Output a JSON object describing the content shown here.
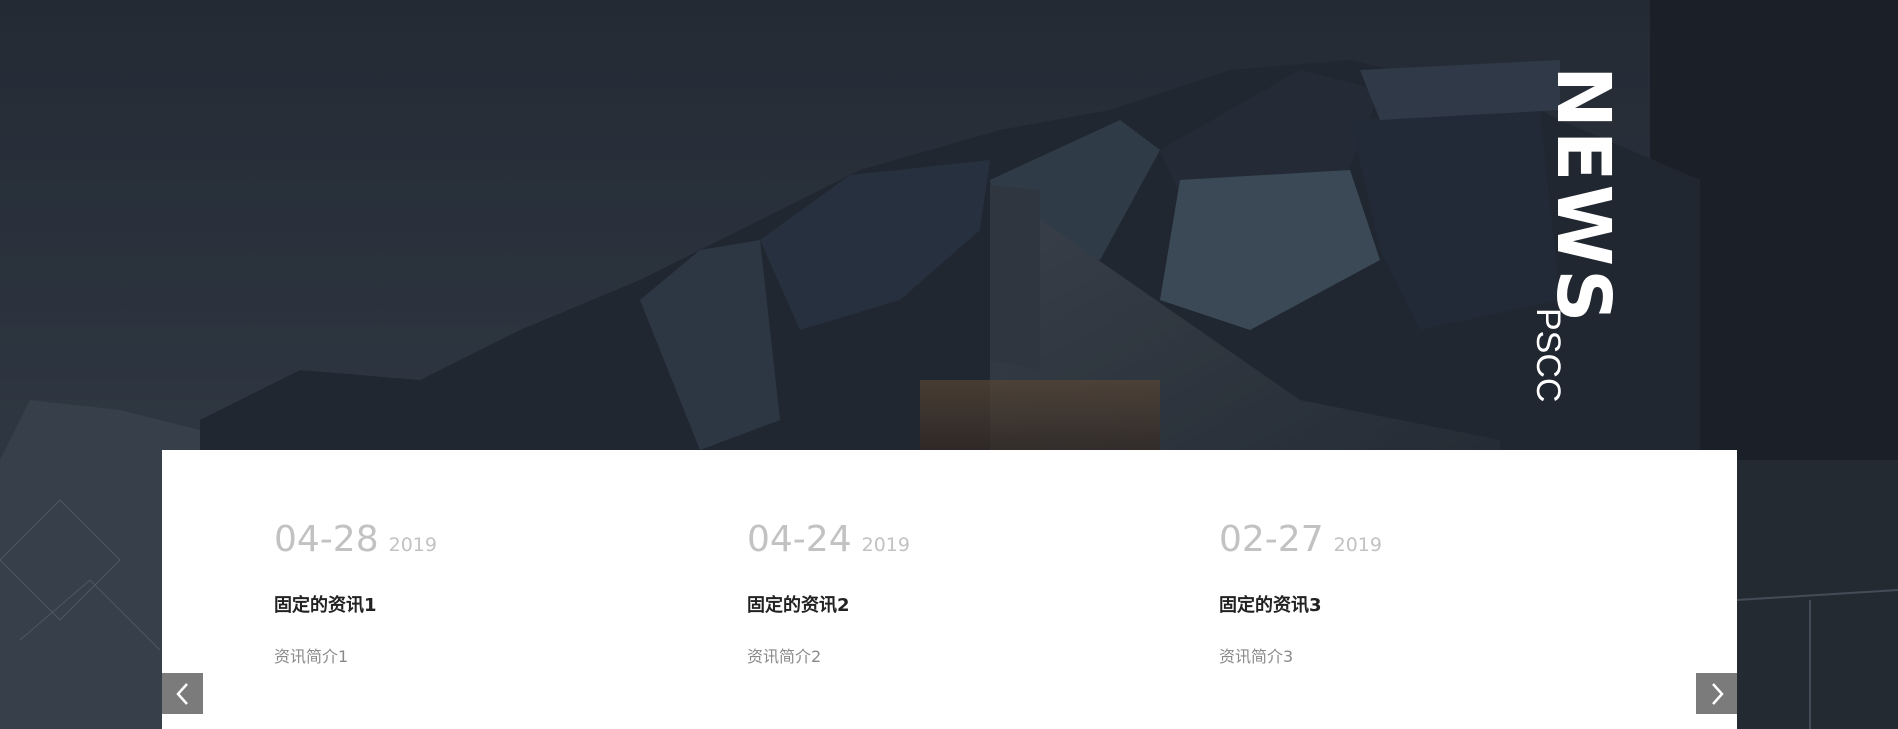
{
  "section": {
    "title": "NEWS",
    "subtitle": "PSCC"
  },
  "news": [
    {
      "date": "04-28",
      "year": "2019",
      "title": "固定的资讯1",
      "summary": "资讯简介1"
    },
    {
      "date": "04-24",
      "year": "2019",
      "title": "固定的资讯2",
      "summary": "资讯简介2"
    },
    {
      "date": "02-27",
      "year": "2019",
      "title": "固定的资讯3",
      "summary": "资讯简介3"
    }
  ],
  "controls": {
    "prev_icon": "chevron-left-icon",
    "next_icon": "chevron-right-icon"
  },
  "colors": {
    "card_background": "#ffffff",
    "date_text": "#c2c2c2",
    "title_text": "#222222",
    "summary_text": "#8a8a8a",
    "arrow_background": "#7b7b7b"
  }
}
